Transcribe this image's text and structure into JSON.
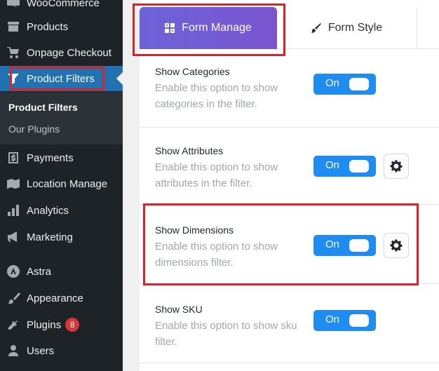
{
  "sidebar": {
    "items": [
      {
        "label": "WooCommerce",
        "icon": "woocommerce-icon"
      },
      {
        "label": "Products",
        "icon": "archive-icon"
      },
      {
        "label": "Onpage Checkout",
        "icon": "cart-icon"
      },
      {
        "label": "Product Filters",
        "icon": "filter-icon"
      },
      {
        "label": "Payments",
        "icon": "dollar-icon"
      },
      {
        "label": "Location Manage",
        "icon": "map-icon"
      },
      {
        "label": "Analytics",
        "icon": "chart-bar-icon"
      },
      {
        "label": "Marketing",
        "icon": "megaphone-icon"
      },
      {
        "label": "Astra",
        "icon": "astra-icon"
      },
      {
        "label": "Appearance",
        "icon": "paintbrush-icon"
      },
      {
        "label": "Plugins",
        "icon": "plugin-icon",
        "badge": "8"
      },
      {
        "label": "Users",
        "icon": "user-icon"
      }
    ],
    "submenu": [
      {
        "label": "Product Filters"
      },
      {
        "label": "Our Plugins"
      }
    ]
  },
  "tabs": [
    {
      "label": "Form Manage",
      "icon": "grid-icon"
    },
    {
      "label": "Form Style",
      "icon": "brush-icon"
    }
  ],
  "settings": [
    {
      "title": "Show Categories",
      "desc": "Enable this option to show categories in the filter.",
      "toggle": "On"
    },
    {
      "title": "Show Attributes",
      "desc": "Enable this option to show attributes in the filter.",
      "toggle": "On"
    },
    {
      "title": "Show Dimensions",
      "desc": "Enable this option to show dimensions filter.",
      "toggle": "On"
    },
    {
      "title": "Show SKU",
      "desc": "Enable this option to show sku filter.",
      "toggle": "On"
    }
  ],
  "colors": {
    "sidebar_bg": "#1d2327",
    "active_menu": "#2271b1",
    "tab_gradient_start": "#6c63d8",
    "tab_gradient_end": "#7b55d0",
    "toggle_on": "#1e8cf0",
    "highlight": "#d9232a",
    "badge": "#d63638"
  }
}
